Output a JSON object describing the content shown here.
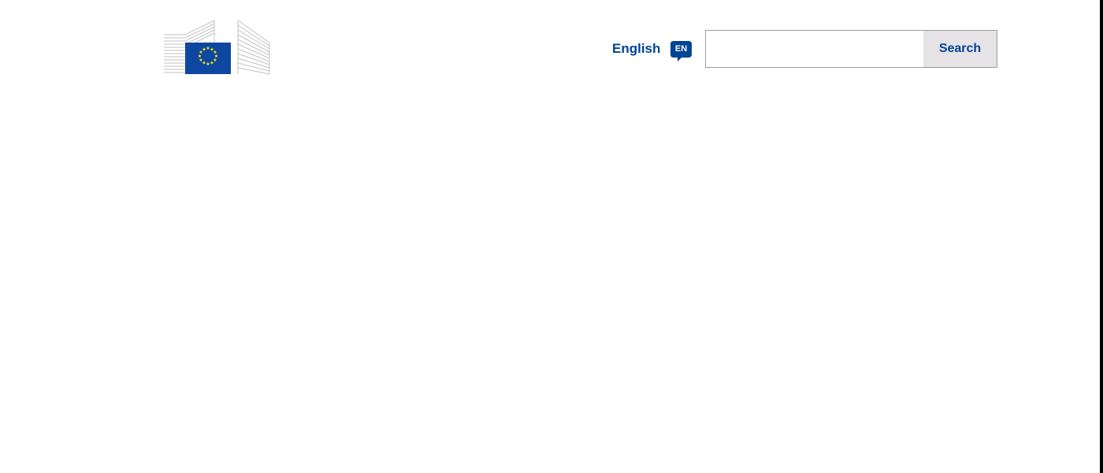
{
  "header": {
    "logo_icon": "european-commission-logo",
    "language": {
      "label": "English",
      "code": "EN",
      "icon": "speech-bubble-icon"
    },
    "search": {
      "value": "",
      "placeholder": "",
      "button_label": "Search"
    }
  },
  "colors": {
    "primary": "#004494",
    "flag_blue": "#0e47a1",
    "flag_star": "#ffed00",
    "logo_gray": "#bdbdbd",
    "search_button_bg": "#e6e3e6",
    "input_border": "#9b9b9b"
  }
}
